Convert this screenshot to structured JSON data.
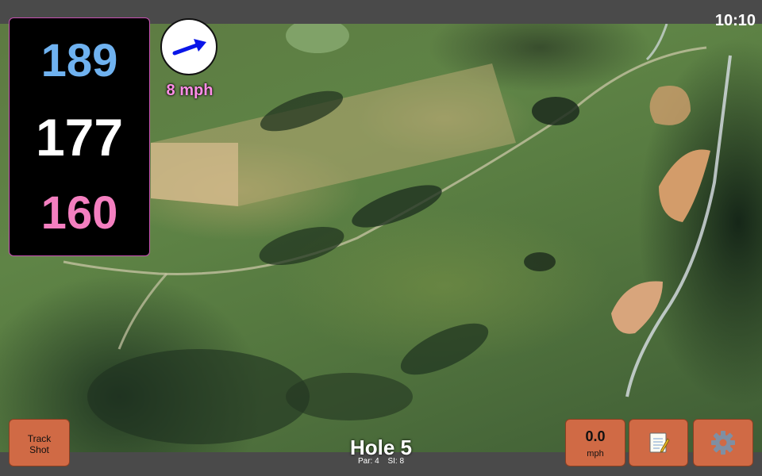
{
  "status": {
    "time": "10:10"
  },
  "distances": {
    "back": "189",
    "middle": "177",
    "front": "160"
  },
  "wind": {
    "speed": "8 mph",
    "icon": "wind-direction-arrow-icon"
  },
  "hole": {
    "title": "Hole 5",
    "par": "Par: 4",
    "stroke_index": "SI: 8"
  },
  "buttons": {
    "track_shot_line1": "Track",
    "track_shot_line2": "Shot",
    "speed_value": "0.0",
    "speed_unit": "mph",
    "notes_icon": "notepad-icon",
    "settings_icon": "gear-icon"
  },
  "colors": {
    "button_bg": "#d06a45",
    "back_distance": "#6fb2f0",
    "middle_distance": "#ffffff",
    "front_distance": "#f47fc0",
    "wind_text": "#ff8ee6",
    "panel_border": "#c850b4"
  }
}
